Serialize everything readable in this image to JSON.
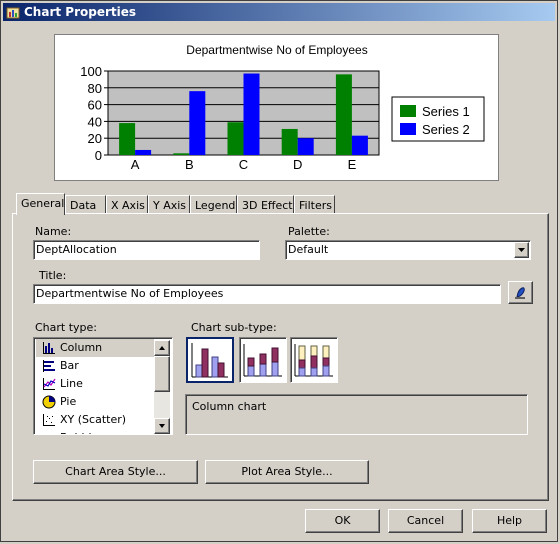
{
  "window": {
    "title": "Chart Properties"
  },
  "chart_data": {
    "type": "bar",
    "title": "Departmentwise No of Employees",
    "categories": [
      "A",
      "B",
      "C",
      "D",
      "E"
    ],
    "series": [
      {
        "name": "Series 1",
        "color": "#008000",
        "values": [
          38,
          2,
          39,
          31,
          96
        ]
      },
      {
        "name": "Series 2",
        "color": "#0000ff",
        "values": [
          6,
          76,
          97,
          20,
          23
        ]
      }
    ],
    "ylim": [
      0,
      100
    ],
    "yticks": [
      "0",
      "20",
      "40",
      "60",
      "80",
      "100"
    ],
    "grid": true,
    "plot_background": "#c0c0c0",
    "legend_position": "right"
  },
  "tabs": [
    {
      "label": "General",
      "active": true
    },
    {
      "label": "Data"
    },
    {
      "label": "X Axis"
    },
    {
      "label": "Y Axis"
    },
    {
      "label": "Legend"
    },
    {
      "label": "3D Effect"
    },
    {
      "label": "Filters"
    }
  ],
  "general": {
    "name_label": "Name:",
    "name_value": "DeptAllocation",
    "palette_label": "Palette:",
    "palette_value": "Default",
    "title_label": "Title:",
    "title_value": "Departmentwise No of Employees",
    "chart_type_label": "Chart type:",
    "chart_types": [
      {
        "label": "Column",
        "icon": "column-chart-icon",
        "selected": true
      },
      {
        "label": "Bar",
        "icon": "bar-chart-icon"
      },
      {
        "label": "Line",
        "icon": "line-chart-icon"
      },
      {
        "label": "Pie",
        "icon": "pie-chart-icon"
      },
      {
        "label": "XY (Scatter)",
        "icon": "scatter-chart-icon"
      },
      {
        "label": "Bubble",
        "icon": "bubble-chart-icon"
      }
    ],
    "chart_subtype_label": "Chart sub-type:",
    "subtypes": [
      "clustered-column-icon",
      "stacked-column-icon",
      "percent-stacked-column-icon"
    ],
    "subtype_description": "Column chart",
    "chart_area_style_button": "Chart Area Style...",
    "plot_area_style_button": "Plot Area Style..."
  },
  "footer": {
    "ok": "OK",
    "cancel": "Cancel",
    "help": "Help"
  }
}
